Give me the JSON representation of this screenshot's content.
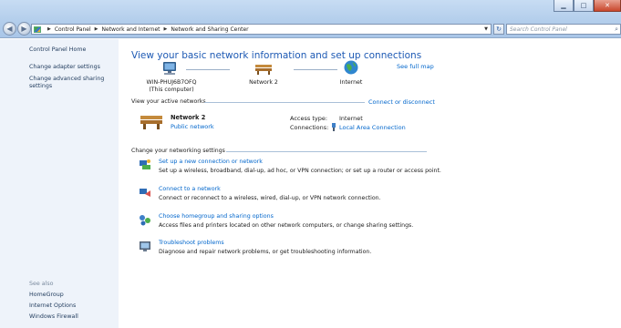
{
  "address": {
    "crumbs": [
      "Control Panel",
      "Network and Internet",
      "Network and Sharing Center"
    ]
  },
  "search": {
    "placeholder": "Search Control Panel"
  },
  "sidebar": {
    "home": "Control Panel Home",
    "links": [
      "Change adapter settings",
      "Change advanced sharing settings"
    ],
    "see_also_heading": "See also",
    "see_also": [
      "HomeGroup",
      "Internet Options",
      "Windows Firewall"
    ]
  },
  "main": {
    "title": "View your basic network information and set up connections",
    "see_full_map": "See full map",
    "map": {
      "computer": "WIN-PHUJ6B7OFQ",
      "computer_sub": "(This computer)",
      "network": "Network 2",
      "internet": "Internet"
    },
    "active_networks": {
      "heading": "View your active networks",
      "connect_link": "Connect or disconnect",
      "network_name": "Network 2",
      "network_type": "Public network",
      "access_type_label": "Access type:",
      "access_type_value": "Internet",
      "connections_label": "Connections:",
      "connections_value": "Local Area Connection"
    },
    "settings": {
      "heading": "Change your networking settings",
      "tasks": [
        {
          "title": "Set up a new connection or network",
          "desc": "Set up a wireless, broadband, dial-up, ad hoc, or VPN connection; or set up a router or access point.",
          "icon": "new-connection-icon"
        },
        {
          "title": "Connect to a network",
          "desc": "Connect or reconnect to a wireless, wired, dial-up, or VPN network connection.",
          "icon": "connect-network-icon"
        },
        {
          "title": "Choose homegroup and sharing options",
          "desc": "Access files and printers located on other network computers, or change sharing settings.",
          "icon": "homegroup-icon"
        },
        {
          "title": "Troubleshoot problems",
          "desc": "Diagnose and repair network problems, or get troubleshooting information.",
          "icon": "troubleshoot-icon"
        }
      ]
    }
  }
}
